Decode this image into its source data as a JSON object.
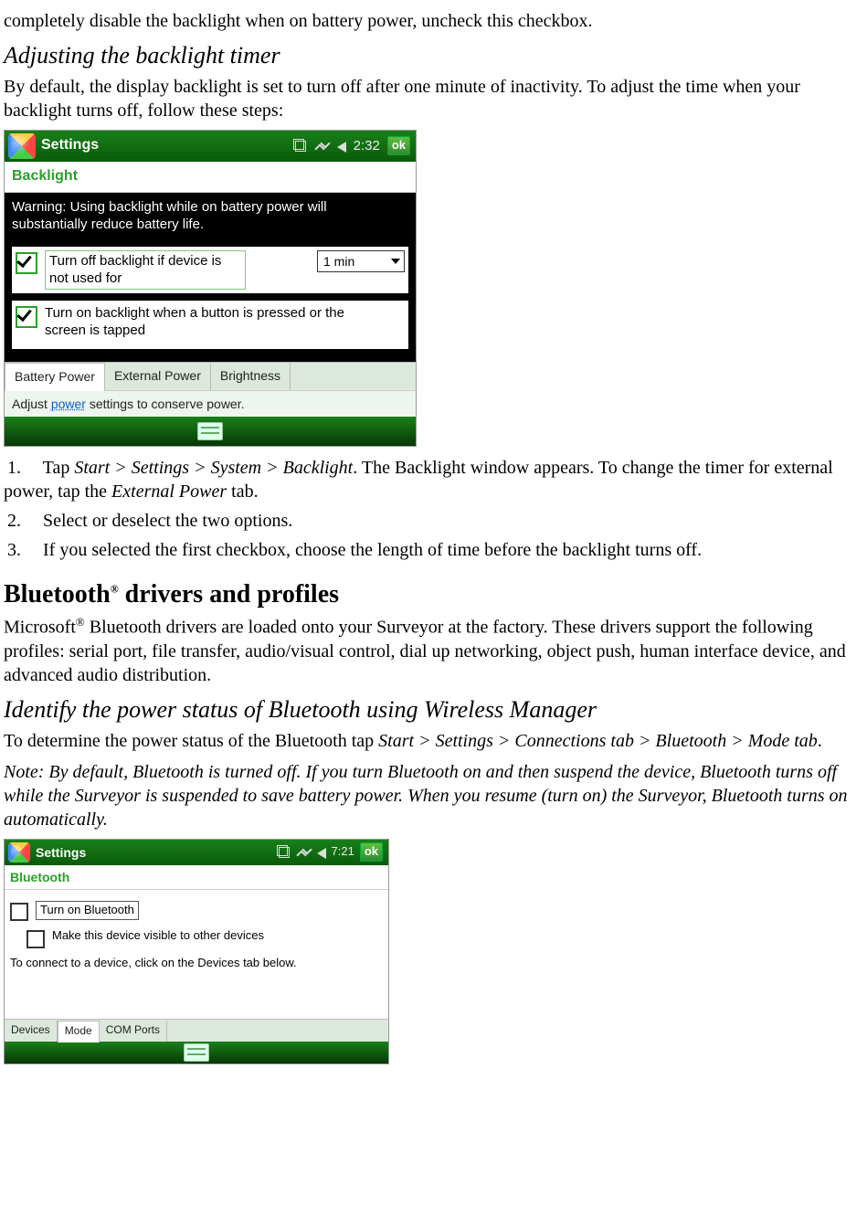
{
  "intro_line": "completely disable the backlight when on battery power, uncheck this checkbox.",
  "section_backlight": {
    "heading": "Adjusting the backlight timer",
    "para": "By default, the display backlight is set to turn off after one minute of inactivity. To adjust the time when your backlight turns off, follow these steps:"
  },
  "screenshot1": {
    "titlebar": {
      "title": "Settings",
      "time": "2:32",
      "ok": "ok"
    },
    "section_title": "Backlight",
    "warning": "Warning: Using backlight while on battery power will substantially reduce battery life.",
    "opt1": {
      "checked": true,
      "label": "Turn off backlight if device is not used for",
      "select_value": "1 min"
    },
    "opt2": {
      "checked": true,
      "label": "Turn on backlight when a button is pressed or the screen is tapped"
    },
    "tabs": [
      "Battery Power",
      "External Power",
      "Brightness"
    ],
    "active_tab_index": 0,
    "hint_pre": "Adjust ",
    "hint_link": "power",
    "hint_post": " settings to conserve power."
  },
  "steps_backlight": [
    {
      "pre": "Tap ",
      "path": "Start > Settings > System > Backlight",
      "post1": ". The Backlight window appears. To change the timer for external power, tap the ",
      "path2": "External Power",
      "post2": " tab."
    },
    {
      "text": "Select or deselect the two options."
    },
    {
      "text": "If you selected the first checkbox, choose the length of time before the backlight turns off."
    }
  ],
  "section_bt": {
    "heading_strong1": "Bluetooth",
    "heading_reg": "®",
    "heading_strong2": " drivers and profiles",
    "para1_pre": "Microsoft",
    "para1_reg": "®",
    "para1_post": " Bluetooth drivers are loaded onto your Surveyor at the factory. These drivers support the following profiles: serial port, file transfer, audio/visual control, dial up networking, object push, human interface device, and advanced audio distribution.",
    "sub_heading": "Identify the power status of Bluetooth using Wireless Manager",
    "para2_pre": "To determine the power status of the Bluetooth tap ",
    "para2_path": "Start > Settings > Connections tab > Bluetooth > Mode tab",
    "para2_post": ".",
    "note": "Note: By default, Bluetooth is turned off. If you turn Bluetooth on and then suspend the device, Bluetooth turns off while the Surveyor is suspended to save battery power. When you resume (turn on) the Surveyor, Bluetooth turns on automatically."
  },
  "screenshot2": {
    "titlebar": {
      "title": "Settings",
      "time": "7:21",
      "ok": "ok"
    },
    "section_title": "Bluetooth",
    "opt1": {
      "checked": false,
      "label": "Turn on Bluetooth"
    },
    "opt2": {
      "checked": false,
      "label": "Make this device visible to other devices"
    },
    "help": "To connect to a device, click on the Devices tab below.",
    "tabs": [
      "Devices",
      "Mode",
      "COM Ports"
    ],
    "active_tab_index": 1
  }
}
